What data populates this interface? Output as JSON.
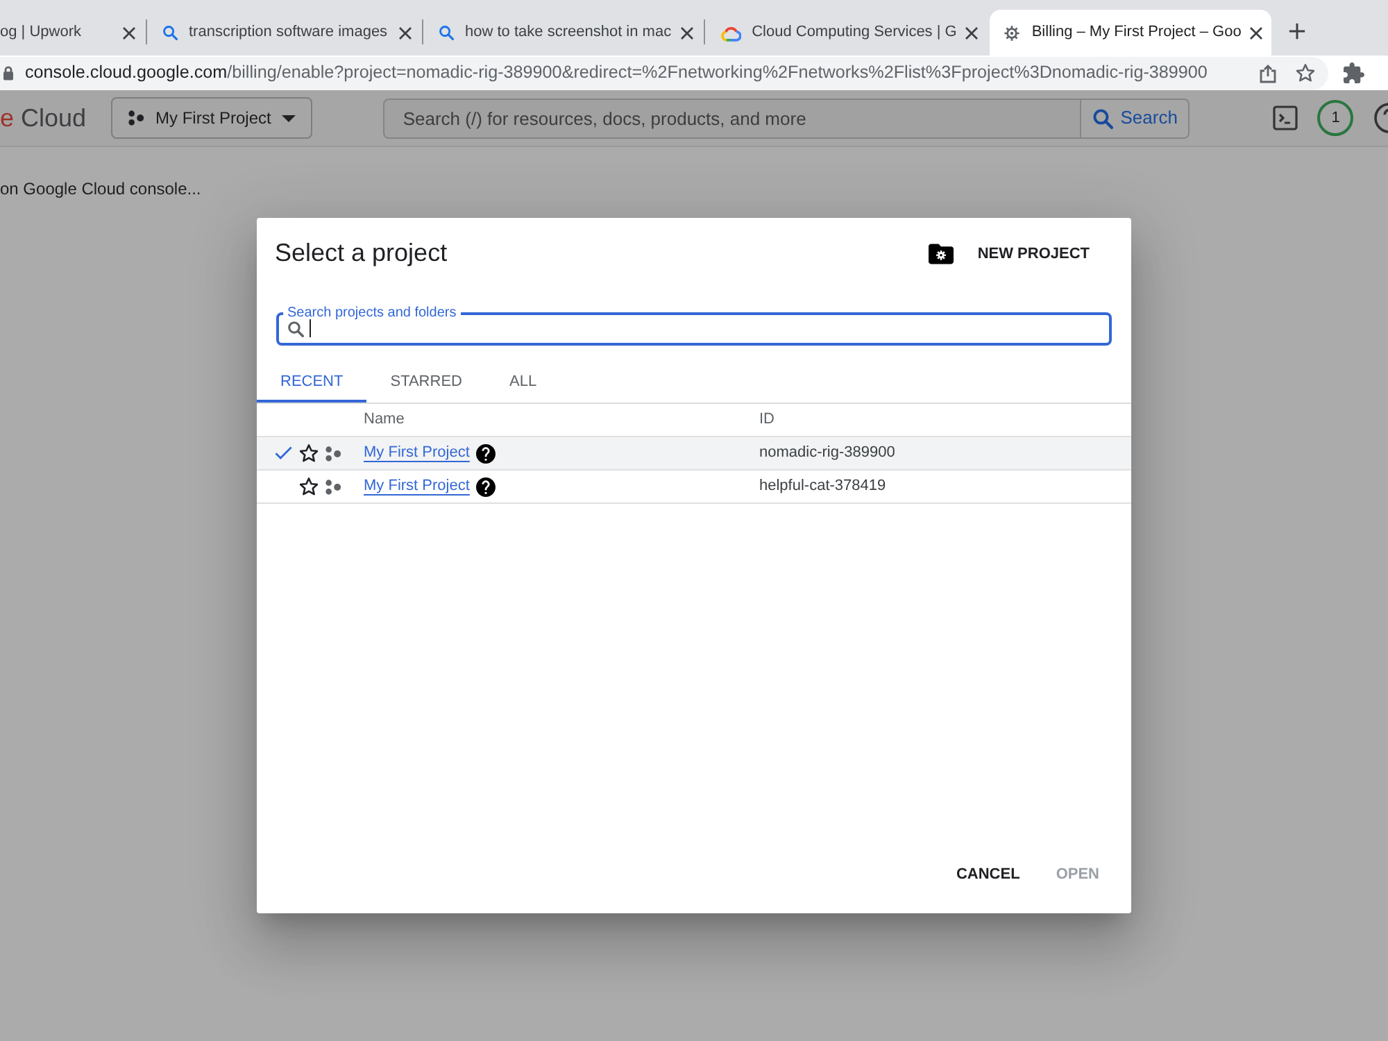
{
  "browser": {
    "tabs": [
      {
        "title": "og | Upwork",
        "kind": "plain",
        "selected": false
      },
      {
        "title": "transcription software images",
        "kind": "search",
        "selected": false
      },
      {
        "title": "how to take screenshot in mac",
        "kind": "search",
        "selected": false
      },
      {
        "title": "Cloud Computing Services | G",
        "kind": "cloud",
        "selected": false
      },
      {
        "title": "Billing – My First Project – Goo",
        "kind": "page",
        "selected": true
      }
    ],
    "address_bar": {
      "domain": "console.cloud.google.com",
      "path": "/billing/enable?project=nomadic-rig-389900&redirect=%2Fnetworking%2Fnetworks%2Flist%3Fproject%3Dnomadic-rig-389900"
    }
  },
  "console": {
    "logo": {
      "letter": "e",
      "product": "Cloud"
    },
    "project_picker": "My First Project",
    "search": {
      "placeholder": "Search (/) for resources, docs, products, and more",
      "button": "Search"
    },
    "notifications": "1",
    "message": "on Google Cloud console..."
  },
  "dialog": {
    "title": "Select a project",
    "new_project": "NEW PROJECT",
    "search": {
      "label": "Search projects and folders",
      "focused": true
    },
    "tabs": [
      {
        "label": "RECENT",
        "selected": true
      },
      {
        "label": "STARRED",
        "selected": false
      },
      {
        "label": "ALL",
        "selected": false
      }
    ],
    "table": {
      "columns": [
        "Name",
        "ID"
      ],
      "rows": [
        {
          "selected": true,
          "starred": false,
          "name": "My First Project",
          "id": "nomadic-rig-389900"
        },
        {
          "selected": false,
          "starred": false,
          "name": "My First Project",
          "id": "helpful-cat-378419"
        }
      ]
    },
    "buttons": [
      {
        "label": "CANCEL",
        "disabled": false
      },
      {
        "label": "OPEN",
        "disabled": true
      }
    ]
  }
}
